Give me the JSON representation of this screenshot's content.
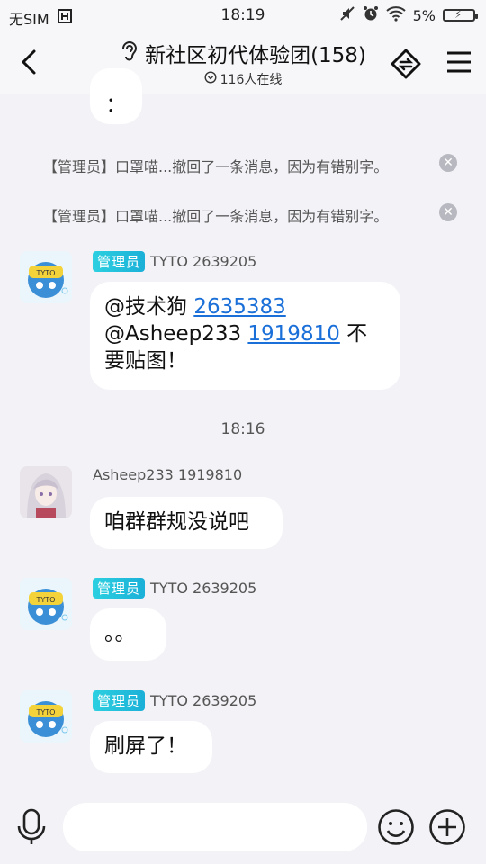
{
  "status_bar": {
    "carrier": "无SIM",
    "time": "18:19",
    "battery": "5%"
  },
  "header": {
    "title": "新社区初代体验团(158)",
    "online": "116人在线"
  },
  "messages": {
    "partial_bubble": "：",
    "notices": [
      {
        "text": "【管理员】口罩喵...撤回了一条消息，因为有错别字。"
      },
      {
        "text": "【管理员】口罩喵...撤回了一条消息，因为有错别字。"
      }
    ],
    "msg1": {
      "badge": "管理员",
      "sender": "TYTO  2639205",
      "line1_prefix": "@技术狗 ",
      "line1_link": "2635383",
      "line2_prefix": "@Asheep233 ",
      "line2_link": "1919810",
      "line2_suffix": " 不",
      "line3": "要贴图！"
    },
    "time_sep": "18:16",
    "msg2": {
      "sender": "Asheep233 1919810",
      "text": "咱群群规没说吧"
    },
    "msg3": {
      "badge": "管理员",
      "sender": "TYTO  2639205",
      "text": "。。"
    },
    "msg4": {
      "badge": "管理员",
      "sender": "TYTO  2639205",
      "text": "刷屏了！"
    }
  },
  "input": {
    "placeholder": ""
  },
  "colors": {
    "background": "#f2f2f7",
    "link": "#1a6fd8",
    "badge": "#1bb0d8"
  }
}
